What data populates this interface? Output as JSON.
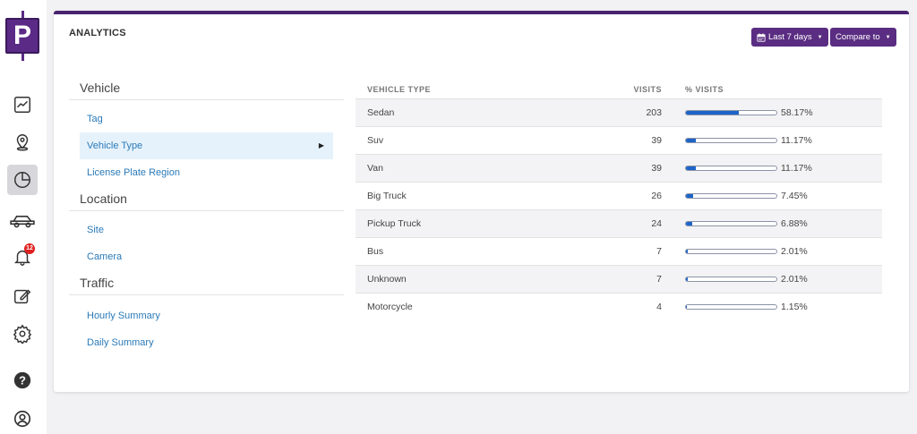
{
  "app": {
    "logo_letter": "P",
    "notification_count": "12"
  },
  "card": {
    "title": "ANALYTICS",
    "date_range_button": "Last 7 days",
    "compare_button": "Compare to"
  },
  "menu": {
    "sections": [
      {
        "title": "Vehicle",
        "items": [
          "Tag",
          "Vehicle Type",
          "License Plate Region"
        ]
      },
      {
        "title": "Location",
        "items": [
          "Site",
          "Camera"
        ]
      },
      {
        "title": "Traffic",
        "items": [
          "Hourly Summary",
          "Daily Summary"
        ]
      }
    ],
    "active_item": "Vehicle Type"
  },
  "table": {
    "headers": {
      "type": "VEHICLE TYPE",
      "visits": "VISITS",
      "pct": "% VISITS"
    },
    "rows": [
      {
        "type": "Sedan",
        "visits": "203",
        "pct": "58.17%",
        "fraction": 0.5817
      },
      {
        "type": "Suv",
        "visits": "39",
        "pct": "11.17%",
        "fraction": 0.1117
      },
      {
        "type": "Van",
        "visits": "39",
        "pct": "11.17%",
        "fraction": 0.1117
      },
      {
        "type": "Big Truck",
        "visits": "26",
        "pct": "7.45%",
        "fraction": 0.0745
      },
      {
        "type": "Pickup Truck",
        "visits": "24",
        "pct": "6.88%",
        "fraction": 0.0688
      },
      {
        "type": "Bus",
        "visits": "7",
        "pct": "2.01%",
        "fraction": 0.0201
      },
      {
        "type": "Unknown",
        "visits": "7",
        "pct": "2.01%",
        "fraction": 0.0201
      },
      {
        "type": "Motorcycle",
        "visits": "4",
        "pct": "1.15%",
        "fraction": 0.0115
      }
    ]
  },
  "colors": {
    "brand": "#5a2d82",
    "link": "#2a7ab8",
    "bar_fill": "#1e64c8",
    "badge": "#e02020"
  }
}
